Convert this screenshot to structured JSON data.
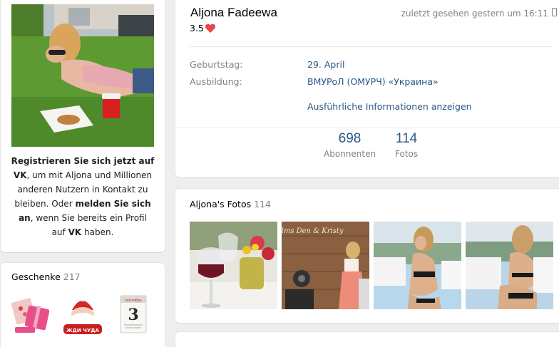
{
  "left": {
    "register_bold": "Registrieren Sie sich jetzt auf VK",
    "register_tail": ",",
    "register_mid": "um mit Aljona und Millionen anderen Nutzern in Kontakt zu bleiben. Oder",
    "login_bold": "melden Sie sich an",
    "register_end": ", wenn Sie bereits ein Profil auf",
    "vk_bold": "VK",
    "register_last": "haben."
  },
  "gifts": {
    "title": "Geschenke",
    "count": "217",
    "calendar_month": "сентябрь",
    "calendar_day": "3",
    "gift2_text": "ЖДИ ЧУДА"
  },
  "profile": {
    "name": "Aljona Fadeewa",
    "rating": "3.5",
    "last_seen": "zuletzt gesehen gestern um 16:11",
    "birthday_label": "Geburtstag:",
    "birthday_value": "29. April",
    "education_label": "Ausbildung:",
    "education_value": "ВМУРоЛ (ОМУРЧ) «Украина»",
    "more_info": "Ausführliche Informationen anzeigen",
    "followers_count": "698",
    "followers_label": "Abonnenten",
    "photos_count": "114",
    "photos_label": "Fotos"
  },
  "photos": {
    "title": "Aljona's Fotos",
    "count": "114",
    "photo2_sign": "Films Den & Kristy"
  },
  "colors": {
    "link": "#2a5885",
    "muted": "#828282",
    "background": "#edeef0",
    "heart": "#e64646"
  }
}
